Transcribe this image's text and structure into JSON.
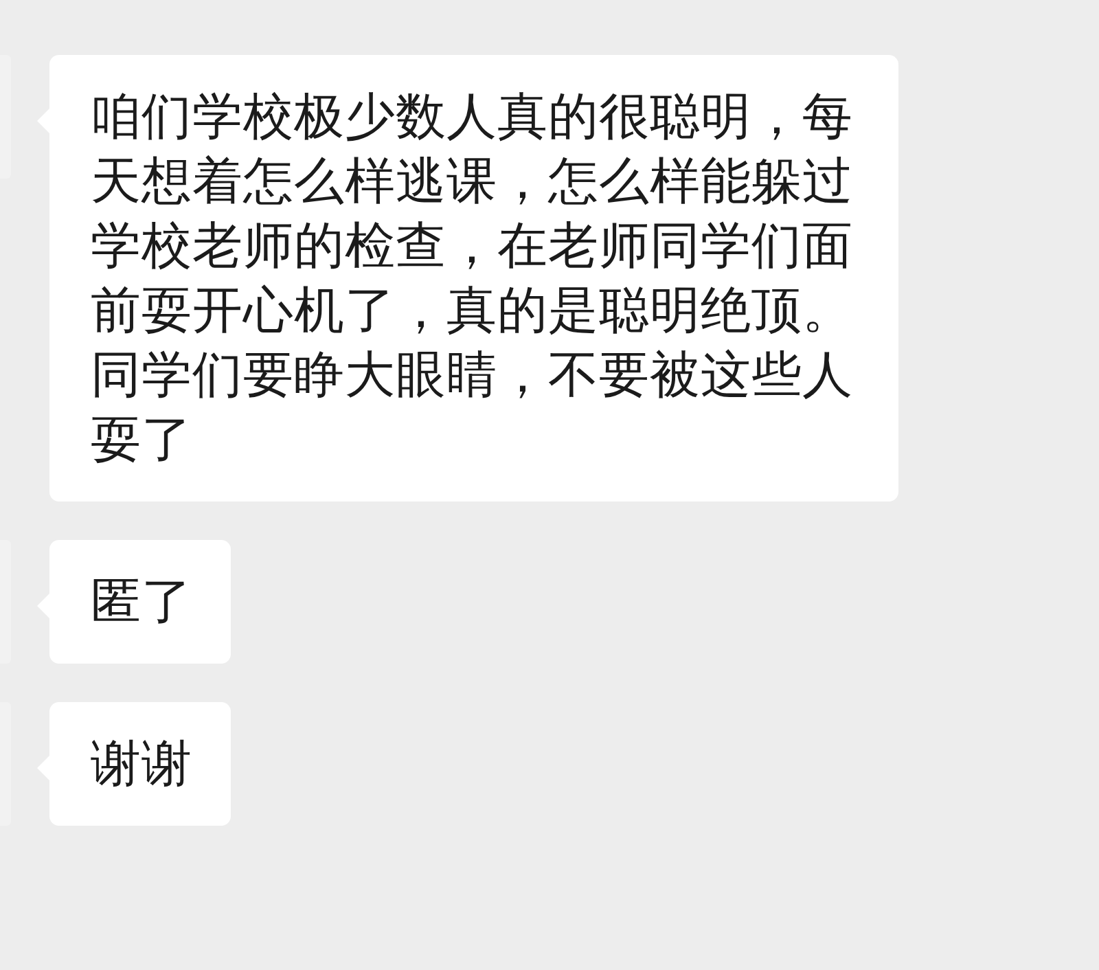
{
  "messages": [
    {
      "text": "咱们学校极少数人真的很聪明，每天想着怎么样逃课，怎么样能躲过学校老师的检查，在老师同学们面前耍开心机了，真的是聪明绝顶。同学们要睁大眼睛，不要被这些人耍了"
    },
    {
      "text": "匿了"
    },
    {
      "text": "谢谢"
    }
  ]
}
